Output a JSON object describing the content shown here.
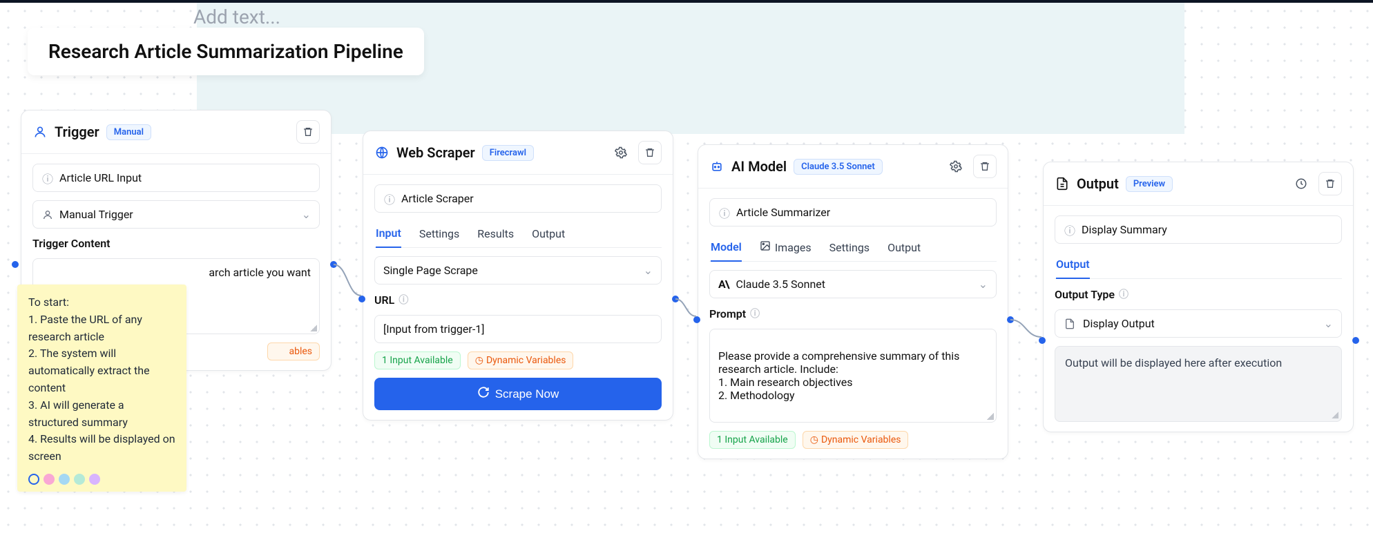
{
  "page": {
    "title": "Research Article Summarization Pipeline",
    "add_text_placeholder": "Add text..."
  },
  "sticky_note": {
    "text": "To start:\n1. Paste the URL of any research article\n2. The system will automatically extract the content\n3. AI will generate a structured summary\n4. Results will be displayed on screen",
    "colors": [
      "#f9a8d4",
      "#a5d8f3",
      "#b5ead7",
      "#d8b4fe"
    ]
  },
  "trigger": {
    "title": "Trigger",
    "badge": "Manual",
    "name_field": "Article URL Input",
    "type_value": "Manual Trigger",
    "content_label": "Trigger Content",
    "content_value": "arch article you want",
    "dynamic_variables_visible": "ables"
  },
  "scraper": {
    "title": "Web Scraper",
    "badge": "Firecrawl",
    "name_field": "Article Scraper",
    "tabs": [
      "Input",
      "Settings",
      "Results",
      "Output"
    ],
    "active_tab": "Input",
    "mode_value": "Single Page Scrape",
    "url_label": "URL",
    "url_value": "[Input from trigger-1]",
    "input_available": "1 Input Available",
    "dynamic_variables": "Dynamic Variables",
    "scrape_button": "Scrape Now"
  },
  "ai": {
    "title": "AI Model",
    "badge": "Claude 3.5 Sonnet",
    "name_field": "Article Summarizer",
    "tabs": [
      "Model",
      "Images",
      "Settings",
      "Output"
    ],
    "active_tab": "Model",
    "model_value": "Claude 3.5 Sonnet",
    "prompt_label": "Prompt",
    "prompt_value": "Please provide a comprehensive summary of this research article. Include:\n1. Main research objectives\n2. Methodology",
    "input_available": "1 Input Available",
    "dynamic_variables": "Dynamic Variables"
  },
  "output": {
    "title": "Output",
    "badge": "Preview",
    "name_field": "Display Summary",
    "tab_label": "Output",
    "type_label": "Output Type",
    "type_value": "Display Output",
    "placeholder": "Output will be displayed here after execution"
  }
}
